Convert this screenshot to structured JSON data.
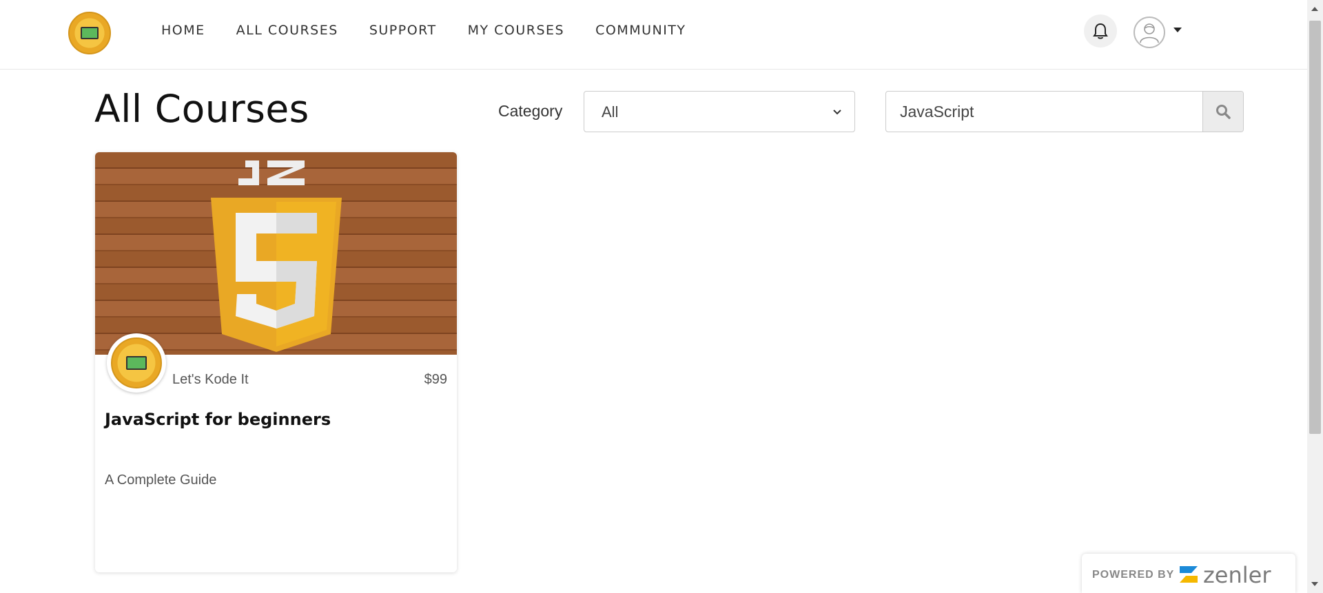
{
  "nav": {
    "items": [
      {
        "label": "HOME"
      },
      {
        "label": "ALL COURSES"
      },
      {
        "label": "SUPPORT"
      },
      {
        "label": "MY COURSES"
      },
      {
        "label": "COMMUNITY"
      }
    ]
  },
  "header": {
    "logo_icon": "school-logo-icon",
    "bell_icon": "bell-icon",
    "avatar_icon": "user-avatar-icon",
    "caret_icon": "caret-down-icon"
  },
  "page": {
    "title": "All Courses",
    "category_label": "Category",
    "category_value": "All",
    "search_value": "JavaScript"
  },
  "courses": [
    {
      "author": "Let's Kode It",
      "price": "$99",
      "title": "JavaScript for beginners",
      "subtitle": "A Complete Guide",
      "image_icon": "javascript-shield-icon"
    }
  ],
  "footer": {
    "powered_by": "POWERED BY",
    "brand": "zenler"
  },
  "colors": {
    "js_yellow": "#f0b323",
    "wood": "#9b5a2e",
    "zenler_blue": "#1b8ad8",
    "zenler_yellow": "#f5b800"
  }
}
